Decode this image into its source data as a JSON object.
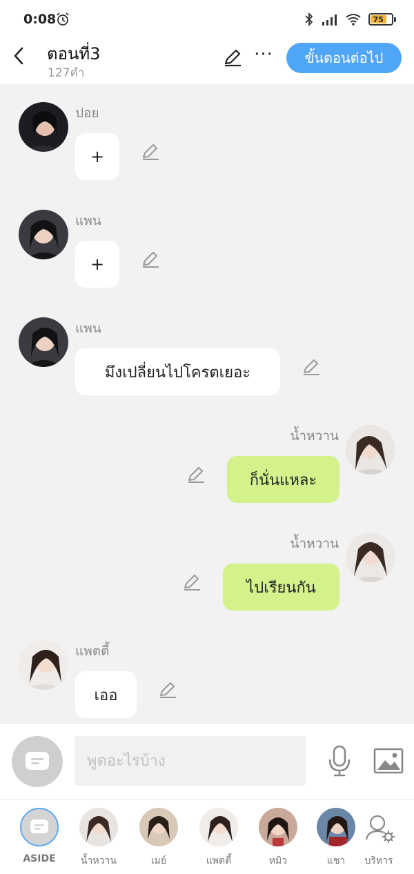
{
  "status": {
    "time": "0:08",
    "battery": "75"
  },
  "header": {
    "title": "ตอนที่3",
    "word_count": "127คำ",
    "next_label": "ขั้นตอนต่อไป"
  },
  "messages": [
    {
      "side": "left",
      "name": "ปอย",
      "text": "+"
    },
    {
      "side": "left",
      "name": "แพน",
      "text": "+"
    },
    {
      "side": "left",
      "name": "แพน",
      "text": "มึงเปลี่ยนไปโครตเยอะ"
    },
    {
      "side": "right",
      "name": "น้ำหวาน",
      "text": "ก็นั่นแหละ"
    },
    {
      "side": "right",
      "name": "น้ำหวาน",
      "text": "ไปเรียนกัน"
    },
    {
      "side": "left",
      "name": "แพตตี้",
      "text": "เออ"
    }
  ],
  "input": {
    "placeholder": "พูดอะไรบ้าง"
  },
  "characters": [
    {
      "label": "ASIDE"
    },
    {
      "label": "น้ำหวาน"
    },
    {
      "label": "เมย์"
    },
    {
      "label": "แพตตี้"
    },
    {
      "label": "หมิว"
    },
    {
      "label": "แชา"
    },
    {
      "label": "บริหาร"
    }
  ],
  "colors": {
    "accent": "#4fa6f6",
    "own_bubble": "#d3f28c",
    "other_bubble": "#ffffff",
    "background": "#f2f2f2"
  }
}
